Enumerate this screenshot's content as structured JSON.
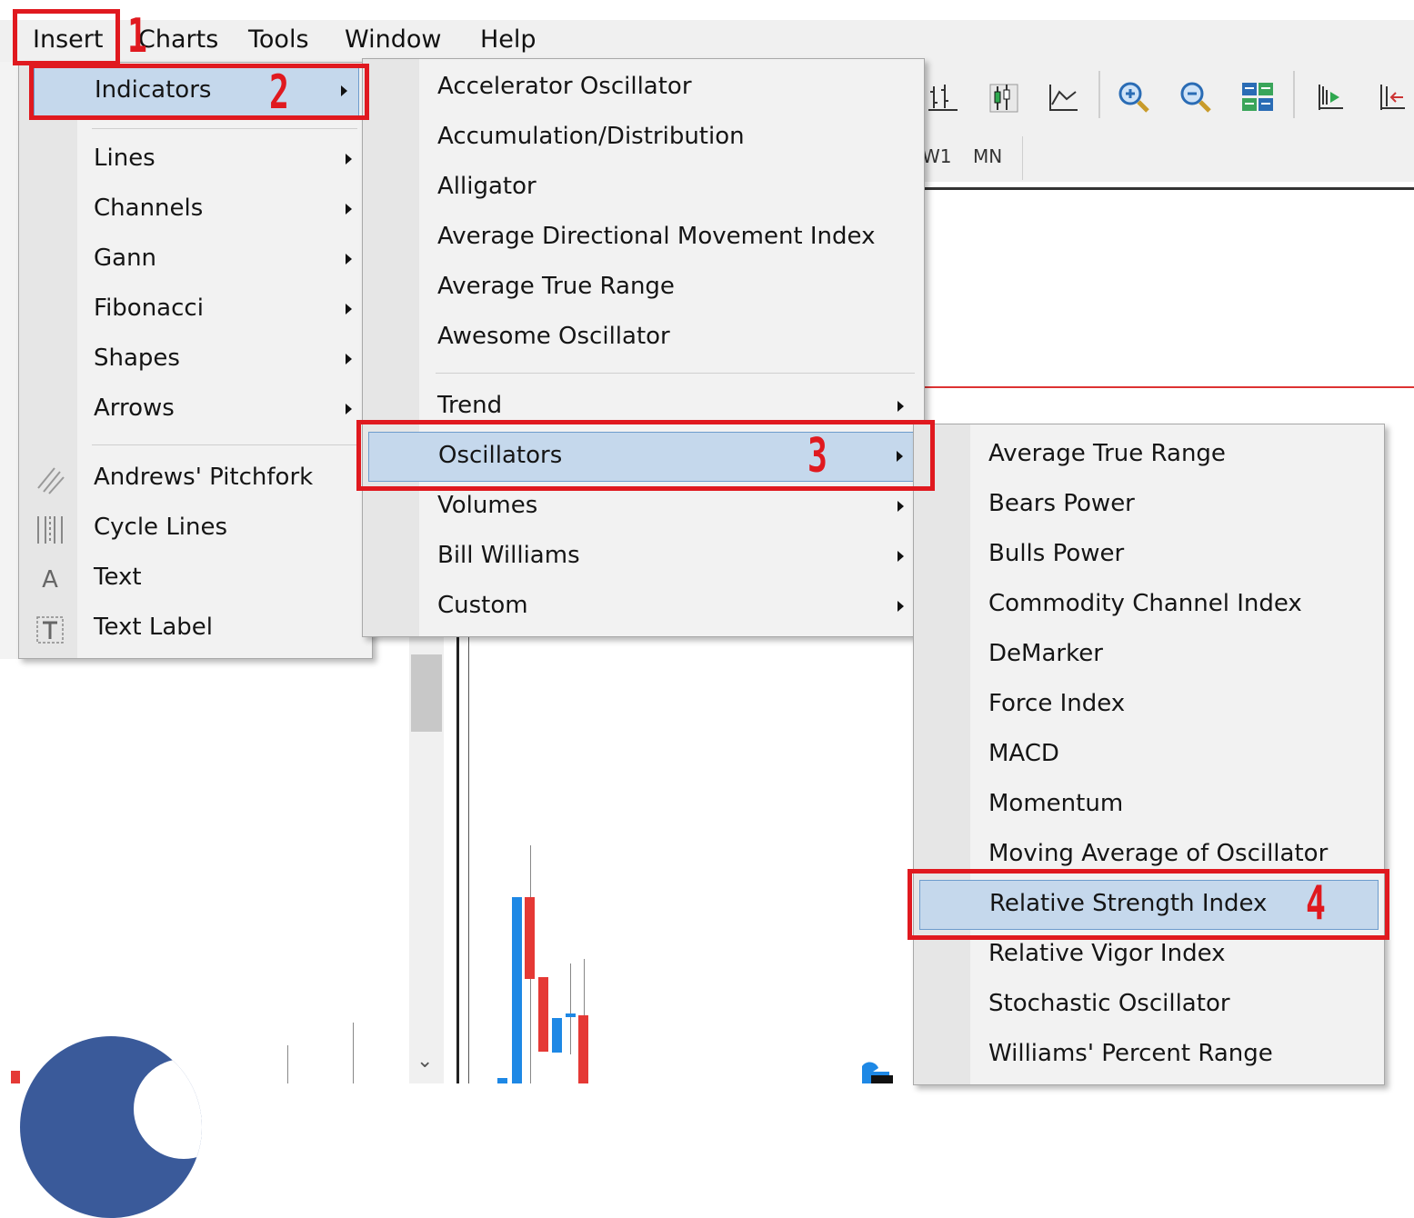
{
  "menubar": {
    "items": [
      "Insert",
      "Charts",
      "Tools",
      "Window",
      "Help"
    ]
  },
  "toolbar": {
    "timeframes": [
      "W1",
      "MN"
    ],
    "icons": [
      "bar-chart-icon",
      "candlestick-chart-icon",
      "line-chart-icon",
      "zoom-in-icon",
      "zoom-out-icon",
      "tile-windows-icon",
      "chart-shift-icon",
      "autoscroll-icon"
    ]
  },
  "insert_menu": {
    "indicators": "Indicators",
    "items": [
      "Lines",
      "Channels",
      "Gann",
      "Fibonacci",
      "Shapes",
      "Arrows"
    ],
    "tools": [
      {
        "label": "Andrews' Pitchfork",
        "icon": "pitchfork-icon"
      },
      {
        "label": "Cycle Lines",
        "icon": "cycle-lines-icon"
      },
      {
        "label": "Text",
        "icon": "text-icon"
      },
      {
        "label": "Text Label",
        "icon": "text-label-icon"
      }
    ]
  },
  "indicators_menu": {
    "items": [
      "Accelerator Oscillator",
      "Accumulation/Distribution",
      "Alligator",
      "Average Directional Movement Index",
      "Average True Range",
      "Awesome Oscillator"
    ],
    "submenus": [
      "Trend",
      "Oscillators",
      "Volumes",
      "Bill Williams",
      "Custom"
    ]
  },
  "oscillators_menu": {
    "items": [
      "Average True Range",
      "Bears Power",
      "Bulls Power",
      "Commodity Channel Index",
      "DeMarker",
      "Force Index",
      "MACD",
      "Momentum",
      "Moving Average of Oscillator",
      "Relative Strength Index",
      "Relative Vigor Index",
      "Stochastic Oscillator",
      "Williams' Percent Range"
    ]
  },
  "annotations": {
    "step1": "1",
    "step2": "2",
    "step3": "3",
    "step4": "4",
    "color": "#e0191f"
  },
  "colors": {
    "highlight": "#c5d8ec",
    "bull_candle": "#1e88e5",
    "bear_candle": "#e53935"
  }
}
